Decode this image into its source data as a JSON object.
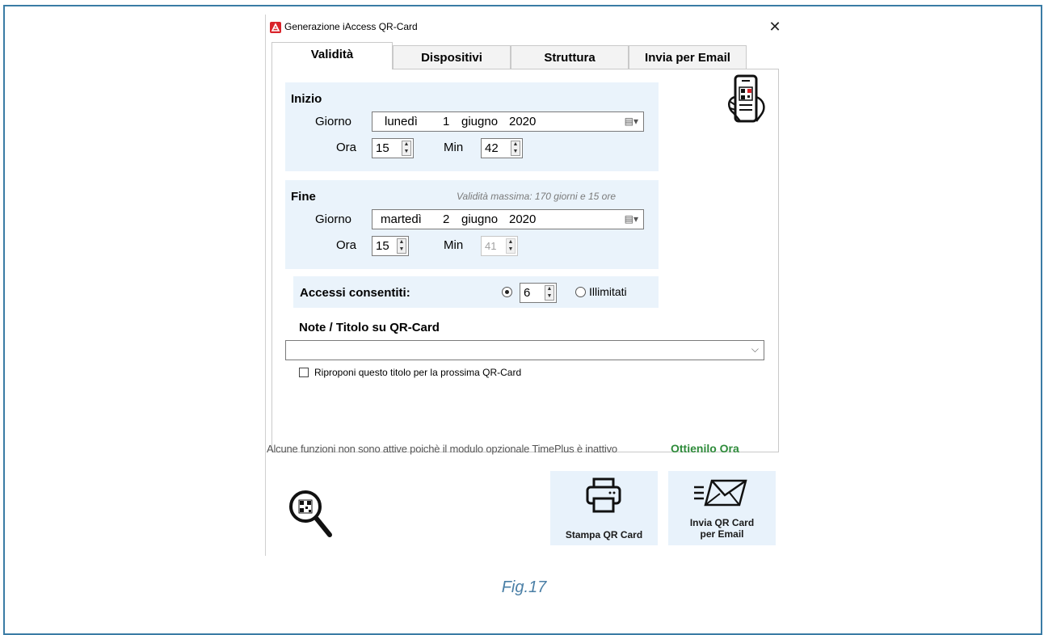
{
  "window": {
    "title": "Generazione iAccess QR-Card",
    "close": "✕"
  },
  "tabs": [
    {
      "label": "Validità",
      "active": true
    },
    {
      "label": "Dispositivi",
      "active": false
    },
    {
      "label": "Struttura",
      "active": false
    },
    {
      "label": "Invia per Email",
      "active": false
    }
  ],
  "inizio": {
    "title": "Inizio",
    "giorno_label": "Giorno",
    "date": {
      "weekday": "lunedì",
      "day": "1",
      "month": "giugno",
      "year": "2020"
    },
    "ora_label": "Ora",
    "ora_value": "15",
    "min_label": "Min",
    "min_value": "42"
  },
  "fine": {
    "title": "Fine",
    "hint": "Validità massima: 170 giorni e 15 ore",
    "giorno_label": "Giorno",
    "date": {
      "weekday": "martedì",
      "day": "2",
      "month": "giugno",
      "year": "2020"
    },
    "ora_label": "Ora",
    "ora_value": "15",
    "min_label": "Min",
    "min_value": "41"
  },
  "accessi": {
    "label": "Accessi consentiti:",
    "count_value": "6",
    "unlimited_label": "Illimitati",
    "selected": "count"
  },
  "note": {
    "label": "Note / Titolo su QR-Card",
    "value": "",
    "checkbox_label": "Riproponi questo titolo per la prossima QR-Card",
    "checked": false
  },
  "notice": {
    "text": "Alcune funzioni non sono attive poichè il modulo opzionale TimePlus è inattivo",
    "link": "Ottienilo Ora"
  },
  "actions": {
    "print_label": "Stampa QR Card",
    "email_label_line1": "Invia QR Card",
    "email_label_line2": "per Email"
  },
  "caption": "Fig.17",
  "colors": {
    "group_bg": "#eaf3fb",
    "link_green": "#2e8b3a",
    "frame_blue": "#3a7ca5"
  }
}
